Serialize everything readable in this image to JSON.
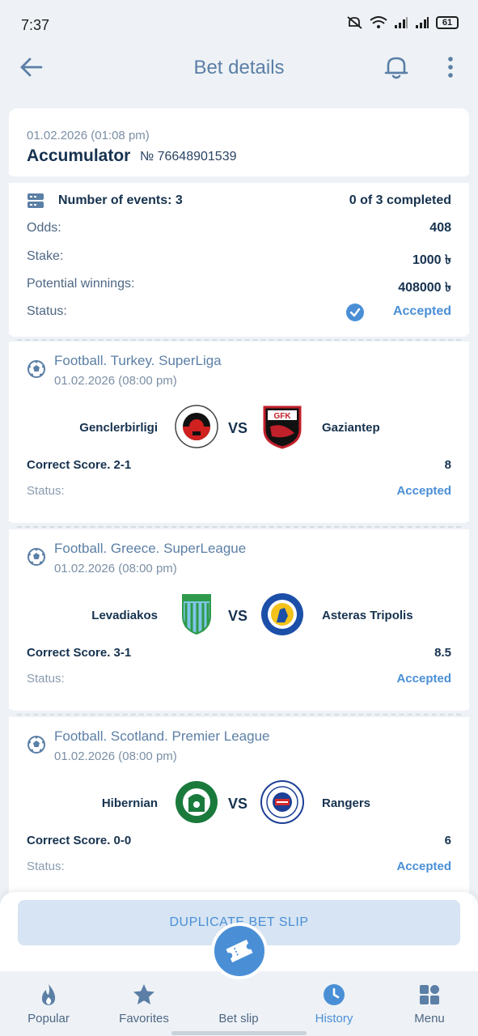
{
  "status_bar": {
    "time": "7:37",
    "battery": "61"
  },
  "header": {
    "title": "Bet details"
  },
  "bet": {
    "datetime": "01.02.2026 (01:08 pm)",
    "type": "Accumulator",
    "number": "№ 76648901539",
    "events_label": "Number of events: 3",
    "events_completed": "0 of 3 completed",
    "odds_label": "Odds:",
    "odds_value": "408",
    "stake_label": "Stake:",
    "stake_value": "1000 ৳",
    "winnings_label": "Potential winnings:",
    "winnings_value": "408000 ৳",
    "status_label": "Status:",
    "status_value": "Accepted"
  },
  "events": [
    {
      "league": "Football. Turkey. SuperLiga",
      "date": "01.02.2026 (08:00 pm)",
      "home": "Genclerbirligi",
      "away": "Gaziantep",
      "vs": "VS",
      "bet": "Correct Score. 2-1",
      "odds": "8",
      "status_label": "Status:",
      "status_value": "Accepted",
      "home_colors": [
        "#111111",
        "#d02020"
      ],
      "away_colors": [
        "#c0202a",
        "#111111"
      ]
    },
    {
      "league": "Football. Greece. SuperLeague",
      "date": "01.02.2026 (08:00 pm)",
      "home": "Levadiakos",
      "away": "Asteras Tripolis",
      "vs": "VS",
      "bet": "Correct Score. 3-1",
      "odds": "8.5",
      "status_label": "Status:",
      "status_value": "Accepted",
      "home_colors": [
        "#2e9a4a",
        "#7fc6e8"
      ],
      "away_colors": [
        "#1c4fa8",
        "#f3c21b"
      ]
    },
    {
      "league": "Football. Scotland. Premier League",
      "date": "01.02.2026 (08:00 pm)",
      "home": "Hibernian",
      "away": "Rangers",
      "vs": "VS",
      "bet": "Correct Score. 0-0",
      "odds": "6",
      "status_label": "Status:",
      "status_value": "Accepted",
      "home_colors": [
        "#1a7a3c",
        "#ffffff"
      ],
      "away_colors": [
        "#1d3f95",
        "#d62a2a"
      ]
    }
  ],
  "actions": {
    "duplicate": "DUPLICATE BET SLIP"
  },
  "nav": [
    {
      "label": "Popular",
      "icon": "flame-icon"
    },
    {
      "label": "Favorites",
      "icon": "star-icon"
    },
    {
      "label": "Bet slip",
      "icon": "ticket-icon"
    },
    {
      "label": "History",
      "icon": "clock-icon"
    },
    {
      "label": "Menu",
      "icon": "grid-icon"
    }
  ],
  "colors": {
    "accent": "#4a8fd6",
    "text_dark": "#16324f",
    "background": "#eef2f6"
  }
}
